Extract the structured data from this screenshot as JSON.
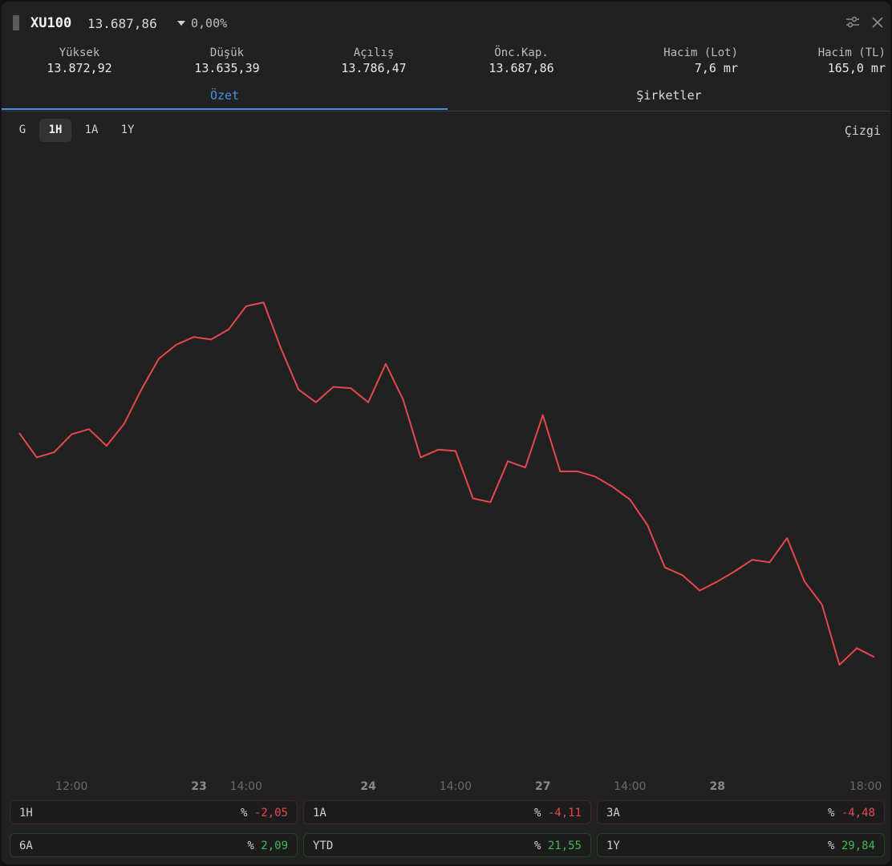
{
  "header": {
    "symbol": "XU100",
    "price": "13.687,86",
    "change": "0,00%",
    "icons": [
      "settings-sliders-icon",
      "close-icon"
    ]
  },
  "stats": [
    {
      "label": "Yüksek",
      "value": "13.872,92"
    },
    {
      "label": "Düşük",
      "value": "13.635,39"
    },
    {
      "label": "Açılış",
      "value": "13.786,47"
    },
    {
      "label": "Önc.Kap.",
      "value": "13.687,86"
    },
    {
      "label": "Hacim (Lot)",
      "value": "7,6 mr"
    },
    {
      "label": "Hacim (TL)",
      "value": "165,0 mr"
    }
  ],
  "tabs": [
    {
      "label": "Özet",
      "active": true
    },
    {
      "label": "Şirketler",
      "active": false
    }
  ],
  "ranges": [
    {
      "label": "G",
      "active": false
    },
    {
      "label": "1H",
      "active": true
    },
    {
      "label": "1A",
      "active": false
    },
    {
      "label": "1Y",
      "active": false
    }
  ],
  "chart_type_label": "Çizgi",
  "chart_data": {
    "type": "line",
    "line_color": "#e5484d",
    "grid": false,
    "legend": "none",
    "x_ticks": [
      {
        "label": "12:00",
        "at": 3,
        "bold": false
      },
      {
        "label": "23",
        "at": 10.3,
        "bold": true
      },
      {
        "label": "14:00",
        "at": 13,
        "bold": false
      },
      {
        "label": "24",
        "at": 20,
        "bold": true
      },
      {
        "label": "14:00",
        "at": 25,
        "bold": false
      },
      {
        "label": "27",
        "at": 30,
        "bold": true
      },
      {
        "label": "14:00",
        "at": 35,
        "bold": false
      },
      {
        "label": "28",
        "at": 40,
        "bold": true
      },
      {
        "label": "18:00",
        "at": 48.5,
        "bold": false
      }
    ],
    "ylim": [
      13585,
      13920
    ],
    "values": [
      13796,
      13777,
      13781,
      13795,
      13799,
      13786,
      13803,
      13830,
      13854,
      13865,
      13871,
      13869,
      13877,
      13895,
      13898,
      13862,
      13830,
      13820,
      13832,
      13831,
      13820,
      13850,
      13822,
      13777,
      13783,
      13782,
      13745,
      13742,
      13774,
      13769,
      13810,
      13766,
      13766,
      13762,
      13754,
      13744,
      13724,
      13691,
      13685,
      13673,
      13680,
      13688,
      13697,
      13695,
      13714,
      13680,
      13662,
      13615,
      13628,
      13621
    ]
  },
  "performance": [
    {
      "label": "1H",
      "prefix": "%",
      "value": "-2,05",
      "color": "#e5484d"
    },
    {
      "label": "1A",
      "prefix": "%",
      "value": "-4,11",
      "color": "#e5484d"
    },
    {
      "label": "3A",
      "prefix": "%",
      "value": "-4,48",
      "color": "#e5484d"
    },
    {
      "label": "6A",
      "prefix": "%",
      "value": "2,09",
      "color": "#3fb950"
    },
    {
      "label": "YTD",
      "prefix": "%",
      "value": "21,55",
      "color": "#3fb950"
    },
    {
      "label": "1Y",
      "prefix": "%",
      "value": "29,84",
      "color": "#3fb950"
    }
  ]
}
